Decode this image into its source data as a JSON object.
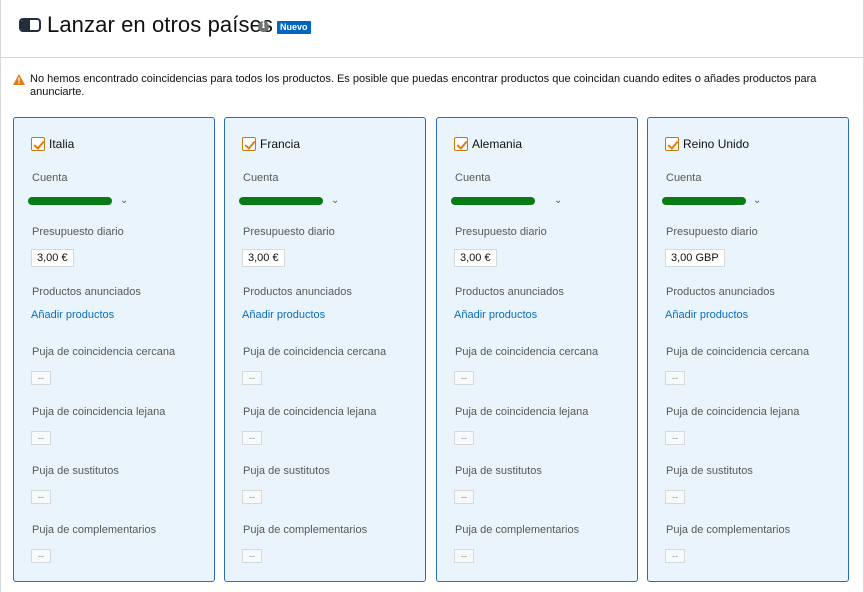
{
  "header": {
    "title": "Lanzar en otros países",
    "badge": "Nuevo",
    "info_icon": "info-icon",
    "toggle_icon": "panel-toggle-icon"
  },
  "warning": {
    "icon": "warning-icon",
    "text": "No hemos encontrado coincidencias para todos los productos. Es posible que puedas encontrar productos que coincidan cuando edites o añades productos para anunciarte."
  },
  "labels": {
    "account": "Cuenta",
    "daily_budget": "Presupuesto diario",
    "advertised_products": "Productos anunciados",
    "add_products": "Añadir productos",
    "close_match_bid": "Puja de coincidencia cercana",
    "loose_match_bid": "Puja de coincidencia lejana",
    "substitutes_bid": "Puja de sustitutos",
    "complements_bid": "Puja de complementarios",
    "empty_value": "--"
  },
  "marketplaces": [
    {
      "country": "Italia",
      "checked": true,
      "account_value": "",
      "budget": "3,00 €"
    },
    {
      "country": "Francia",
      "checked": true,
      "account_value": "",
      "budget": "3,00 €"
    },
    {
      "country": "Alemania",
      "checked": true,
      "account_value": "",
      "budget": "3,00 €"
    },
    {
      "country": "Reino Unido",
      "checked": true,
      "account_value": "",
      "budget": "3,00 GBP"
    }
  ],
  "colors": {
    "card_background": "#eaf4fc",
    "card_border": "#2a6ebb",
    "link": "#0a6ebd",
    "badge": "#0066c0",
    "checkbox": "#e47911",
    "warning": "#e47911",
    "redaction": "#0a7a14"
  }
}
